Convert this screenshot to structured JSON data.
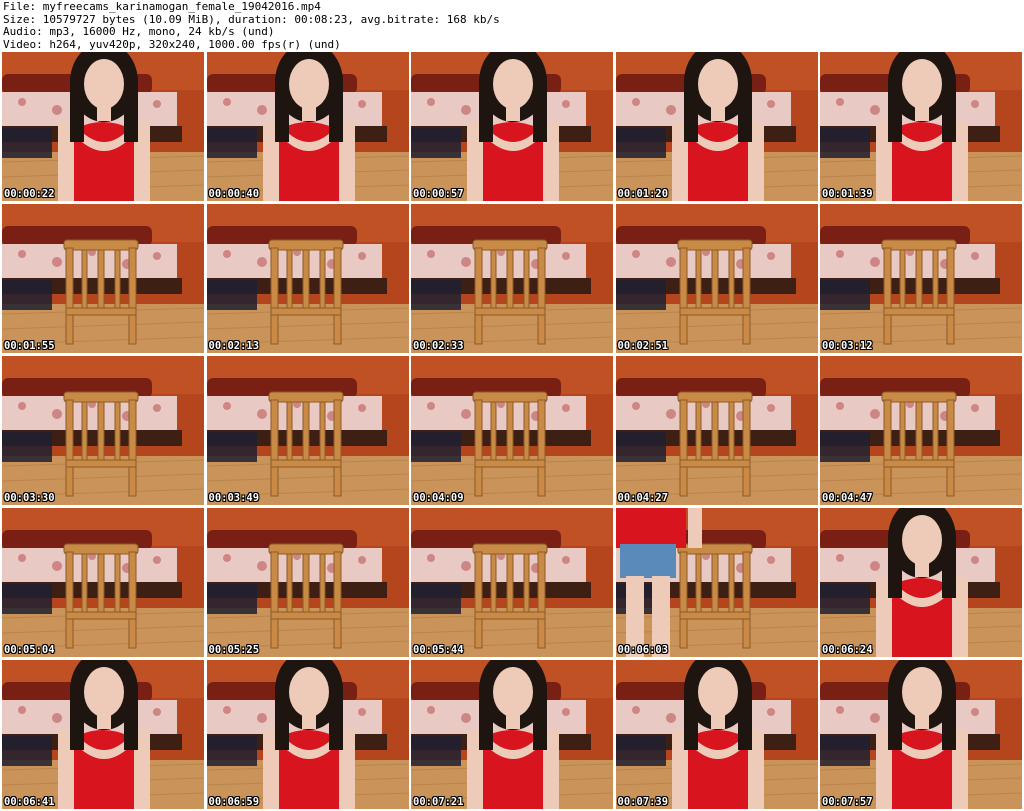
{
  "header": {
    "file_line": "File: myfreecams_karinamogan_female_19042016.mp4",
    "size_line": "Size: 10579727 bytes (10.09 MiB), duration: 00:08:23, avg.bitrate: 168 kb/s",
    "audio_line": "Audio: mp3, 16000 Hz, mono, 24 kb/s (und)",
    "video_line": "Video: h264, yuv420p, 320x240, 1000.00 fps(r) (und)"
  },
  "thumbnails": [
    {
      "time": "00:00:22",
      "scene": "person"
    },
    {
      "time": "00:00:40",
      "scene": "person"
    },
    {
      "time": "00:00:57",
      "scene": "person"
    },
    {
      "time": "00:01:20",
      "scene": "person"
    },
    {
      "time": "00:01:39",
      "scene": "person"
    },
    {
      "time": "00:01:55",
      "scene": "chair"
    },
    {
      "time": "00:02:13",
      "scene": "chair"
    },
    {
      "time": "00:02:33",
      "scene": "chair"
    },
    {
      "time": "00:02:51",
      "scene": "chair"
    },
    {
      "time": "00:03:12",
      "scene": "chair"
    },
    {
      "time": "00:03:30",
      "scene": "chair"
    },
    {
      "time": "00:03:49",
      "scene": "chair"
    },
    {
      "time": "00:04:09",
      "scene": "chair"
    },
    {
      "time": "00:04:27",
      "scene": "chair"
    },
    {
      "time": "00:04:47",
      "scene": "chair"
    },
    {
      "time": "00:05:04",
      "scene": "chair"
    },
    {
      "time": "00:05:25",
      "scene": "chair"
    },
    {
      "time": "00:05:44",
      "scene": "chair"
    },
    {
      "time": "00:06:03",
      "scene": "standing"
    },
    {
      "time": "00:06:24",
      "scene": "person"
    },
    {
      "time": "00:06:41",
      "scene": "person"
    },
    {
      "time": "00:06:59",
      "scene": "person"
    },
    {
      "time": "00:07:21",
      "scene": "person"
    },
    {
      "time": "00:07:39",
      "scene": "person"
    },
    {
      "time": "00:07:57",
      "scene": "person"
    }
  ],
  "colors": {
    "wall": "#b5451c",
    "floor": "#c9935a",
    "dress": "#d8141e",
    "hair": "#1e1510",
    "skin": "#eecab8",
    "bed": "#e8c9c4",
    "chair": "#c98a45"
  }
}
